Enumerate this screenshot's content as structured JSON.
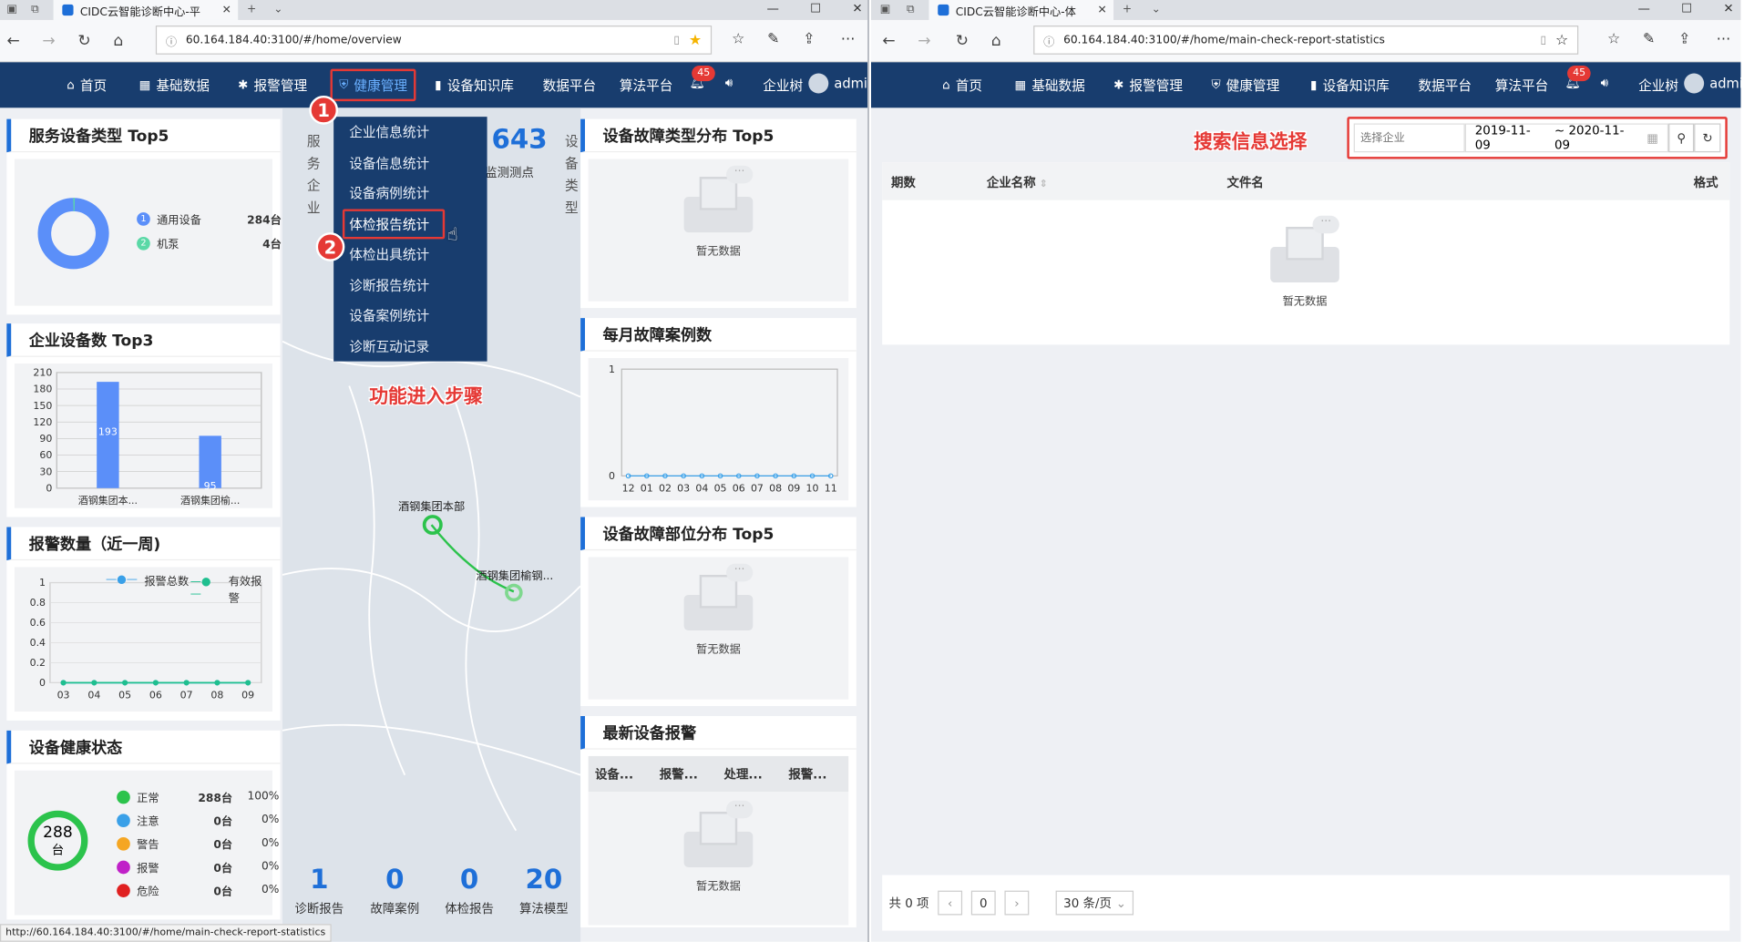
{
  "left": {
    "tab_title": "CIDC云智能诊断中心-平",
    "url": "60.164.184.40:3100/#/home/overview",
    "nav": {
      "home": "首页",
      "basic": "基础数据",
      "alarm": "报警管理",
      "health": "健康管理",
      "knowledge": "设备知识库",
      "data": "数据平台",
      "algo": "算法平台",
      "badge": "45",
      "tree": "企业树",
      "user": "admin"
    },
    "menu": [
      "企业信息统计",
      "设备信息统计",
      "设备病例统计",
      "体检报告统计",
      "体检出具统计",
      "诊断报告统计",
      "设备案例统计",
      "诊断互动记录"
    ],
    "step1": "1",
    "step2": "2",
    "annotation": "功能进入步骤",
    "p1": {
      "title": "服务设备类型 Top5",
      "items": [
        {
          "idx": "1",
          "name": "通用设备",
          "val": "284台",
          "color": "#5b8ff9"
        },
        {
          "idx": "2",
          "name": "机泵",
          "val": "4台",
          "color": "#5ad8a6"
        }
      ]
    },
    "p2": {
      "title": "企业设备数 Top3"
    },
    "p3": {
      "title": "报警数量（近一周)",
      "legend_total": "报警总数",
      "legend_valid": "有效报警"
    },
    "p4": {
      "title": "设备健康状态",
      "center_num": "288",
      "center_unit": "台",
      "rows": [
        {
          "name": "正常",
          "val": "288台",
          "pct": "100%",
          "color": "#2cc34c"
        },
        {
          "name": "注意",
          "val": "0台",
          "pct": "0%",
          "color": "#3aa0e8"
        },
        {
          "name": "警告",
          "val": "0台",
          "pct": "0%",
          "color": "#f5a623"
        },
        {
          "name": "报警",
          "val": "0台",
          "pct": "0%",
          "color": "#c021c8"
        },
        {
          "name": "危险",
          "val": "0台",
          "pct": "0%",
          "color": "#e02020"
        }
      ]
    },
    "map": {
      "left_label": [
        "服",
        "务",
        "企",
        "业"
      ],
      "big_num": "643",
      "big_lab": "监测测点",
      "right_label": [
        "设",
        "备",
        "类",
        "型"
      ],
      "place1": "酒钢集团本部",
      "place2": "酒钢集团榆钢...",
      "stats": [
        {
          "num": "1",
          "lab": "诊断报告"
        },
        {
          "num": "0",
          "lab": "故障案例"
        },
        {
          "num": "0",
          "lab": "体检报告"
        },
        {
          "num": "20",
          "lab": "算法模型"
        }
      ]
    },
    "r1": {
      "title": "设备故障类型分布 Top5"
    },
    "r2": {
      "title": "每月故障案例数"
    },
    "r3": {
      "title": "设备故障部位分布 Top5"
    },
    "r4": {
      "title": "最新设备报警",
      "cols": [
        "设备...",
        "报警...",
        "处理...",
        "报警..."
      ]
    },
    "empty": "暂无数据",
    "status_url": "http://60.164.184.40:3100/#/home/main-check-report-statistics"
  },
  "right": {
    "tab_title": "CIDC云智能诊断中心-体",
    "url": "60.164.184.40:3100/#/home/main-check-report-statistics",
    "annotation": "搜索信息选择",
    "search": {
      "placeholder": "选择企业",
      "from": "2019-11-09",
      "to": "~  2020-11-09"
    },
    "cols": {
      "c1": "期数",
      "c2": "企业名称",
      "c3": "文件名",
      "c4": "格式"
    },
    "empty": "暂无数据",
    "pager": {
      "total": "共 0 项",
      "page": "0",
      "size": "30 条/页"
    }
  },
  "chart_data": [
    {
      "type": "pie",
      "title": "服务设备类型 Top5",
      "categories": [
        "通用设备",
        "机泵"
      ],
      "values": [
        284,
        4
      ]
    },
    {
      "type": "bar",
      "title": "企业设备数 Top3",
      "categories": [
        "酒钢集团本...",
        "酒钢集团榆..."
      ],
      "values": [
        193,
        95
      ],
      "ylim": [
        0,
        210
      ],
      "yticks": [
        0,
        30,
        60,
        90,
        120,
        150,
        180,
        210
      ]
    },
    {
      "type": "line",
      "title": "报警数量（近一周)",
      "categories": [
        "03",
        "04",
        "05",
        "06",
        "07",
        "08",
        "09"
      ],
      "series": [
        {
          "name": "报警总数",
          "values": [
            0,
            0,
            0,
            0,
            0,
            0,
            0
          ]
        },
        {
          "name": "有效报警",
          "values": [
            0,
            0,
            0,
            0,
            0,
            0,
            0
          ]
        }
      ],
      "ylim": [
        0,
        1
      ],
      "yticks": [
        "0",
        "0.2",
        "0.4",
        "0.6",
        "0.8",
        "1"
      ]
    },
    {
      "type": "line",
      "title": "每月故障案例数",
      "categories": [
        "12",
        "01",
        "02",
        "03",
        "04",
        "05",
        "06",
        "07",
        "08",
        "09",
        "10",
        "11"
      ],
      "values": [
        0,
        0,
        0,
        0,
        0,
        0,
        0,
        0,
        0,
        0,
        0,
        0
      ],
      "ylim": [
        0,
        1
      ],
      "yticks": [
        "0",
        "1"
      ]
    }
  ]
}
